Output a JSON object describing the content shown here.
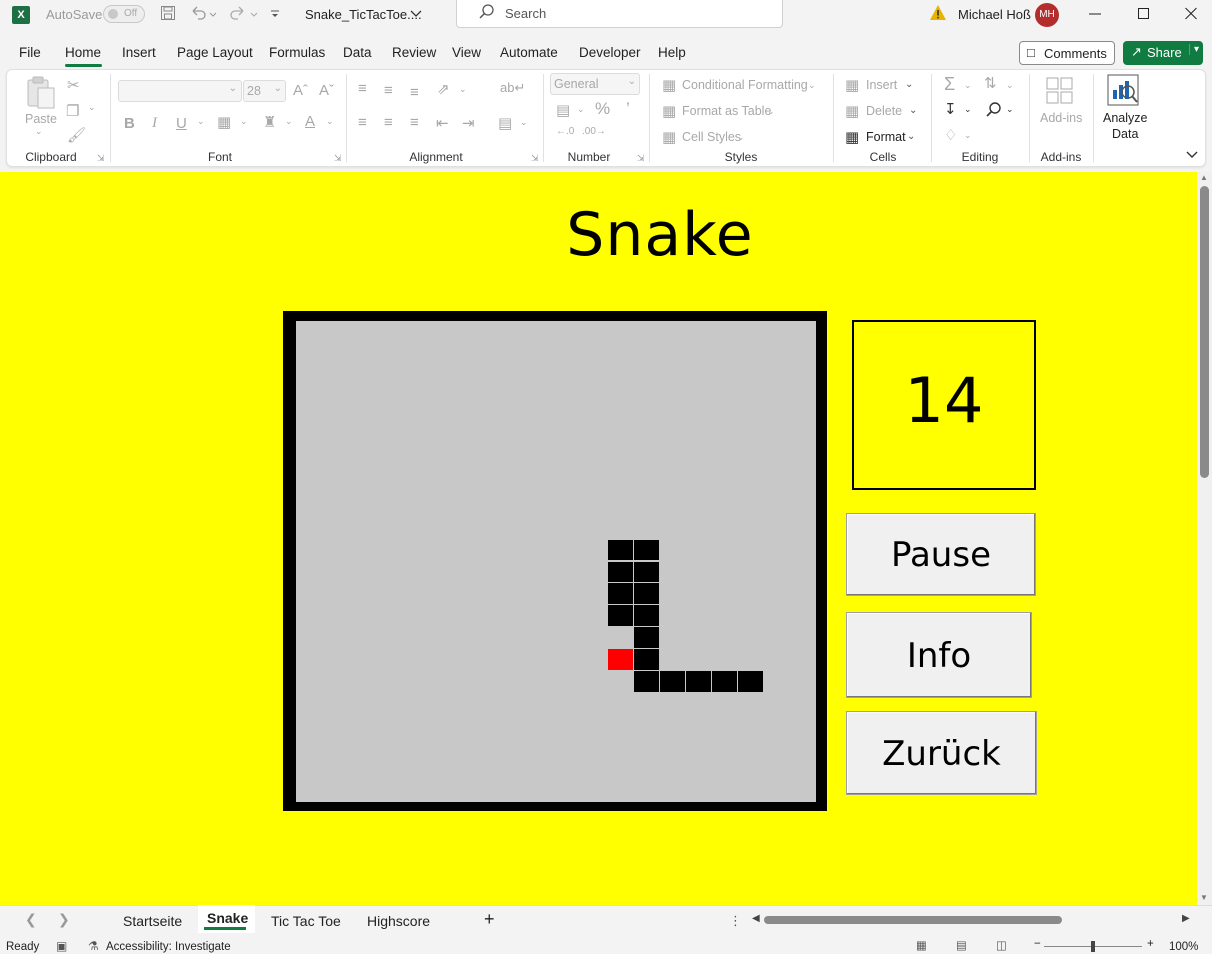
{
  "titlebar": {
    "app_logo": "X",
    "autosave_label": "AutoSave",
    "autosave_state": "Off",
    "filename": "Snake_TicTacToe....",
    "search_placeholder": "Search",
    "user_name": "Michael Hoß",
    "user_initials": "MH"
  },
  "menu": {
    "items": [
      "File",
      "Home",
      "Insert",
      "Page Layout",
      "Formulas",
      "Data",
      "Review",
      "View",
      "Automate",
      "Developer",
      "Help"
    ],
    "active": "Home",
    "comments_label": "Comments",
    "share_label": "Share"
  },
  "ribbon": {
    "clipboard": {
      "paste": "Paste",
      "group": "Clipboard"
    },
    "font": {
      "font_name": "",
      "font_size": "28",
      "group": "Font",
      "bold": "B",
      "italic": "I",
      "underline": "U"
    },
    "alignment": {
      "group": "Alignment"
    },
    "number": {
      "format": "General",
      "group": "Number"
    },
    "styles": {
      "conditional": "Conditional Formatting",
      "format_table": "Format as Table",
      "cell_styles": "Cell Styles",
      "group": "Styles"
    },
    "cells": {
      "insert": "Insert",
      "delete": "Delete",
      "format": "Format",
      "group": "Cells"
    },
    "editing": {
      "group": "Editing"
    },
    "addins": {
      "addins": "Add-ins",
      "group": "Add-ins"
    },
    "analyze": {
      "line1": "Analyze",
      "line2": "Data"
    }
  },
  "game": {
    "title": "Snake",
    "score": "14",
    "pause_label": "Pause",
    "info_label": "Info",
    "back_label": "Zurück",
    "colors": {
      "sheet": "#ffff00",
      "field": "#c8c8c8",
      "snake": "#000000",
      "food": "#ff0000"
    },
    "grid": {
      "cols": 20,
      "rows": 22,
      "snake_cells": [
        [
          12,
          10
        ],
        [
          13,
          10
        ],
        [
          12,
          11
        ],
        [
          13,
          11
        ],
        [
          12,
          12
        ],
        [
          13,
          12
        ],
        [
          12,
          13
        ],
        [
          13,
          13
        ],
        [
          13,
          14
        ],
        [
          13,
          15
        ],
        [
          13,
          16
        ],
        [
          14,
          16
        ],
        [
          15,
          16
        ],
        [
          16,
          16
        ],
        [
          17,
          16
        ]
      ],
      "food_cell": [
        12,
        15
      ]
    }
  },
  "sheets": {
    "tabs": [
      "Startseite",
      "Snake",
      "Tic Tac Toe",
      "Highscore"
    ],
    "active": "Snake",
    "add_label": "+"
  },
  "status": {
    "ready": "Ready",
    "accessibility": "Accessibility: Investigate",
    "zoom": "100%"
  }
}
